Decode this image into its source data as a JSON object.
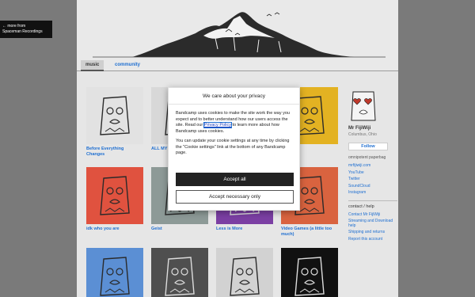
{
  "more_from": {
    "arrow": "←",
    "line1": "more from",
    "line2": "Spaceman Recordings"
  },
  "nav": {
    "music": "music",
    "community": "community"
  },
  "albums": [
    {
      "title": "Before Everything Changes",
      "color": "#e2e2e2"
    },
    {
      "title": "ALL MY",
      "color": "#d8d8d8"
    },
    {
      "title": "",
      "color": "#c9c9c9"
    },
    {
      "title": "D I",
      "color": "#e3b222"
    },
    {
      "title": "idk who you are",
      "color": "#e0523f"
    },
    {
      "title": "Geist",
      "color": "#8d9a97"
    },
    {
      "title": "Less is More",
      "color": "#7b3fa3"
    },
    {
      "title": "Video Games (a little too much)",
      "color": "#d9633f"
    },
    {
      "title": "",
      "color": "#5b8fd4"
    },
    {
      "title": "",
      "color": "#4f4f4f"
    },
    {
      "title": "",
      "color": "#d2d2d2"
    },
    {
      "title": "",
      "color": "#111111"
    }
  ],
  "sidebar": {
    "name": "Mr FijiWiji",
    "location": "Columbus, Ohio",
    "follow": "Follow",
    "description": "omnipotent paperbag",
    "links": [
      "mrfijiwiji.com",
      "YouTube",
      "Twitter",
      "SoundCloud",
      "Instagram"
    ],
    "contact_heading": "contact / help",
    "contact_links": [
      "Contact Mr FijiWiji",
      "Streaming and Download help",
      "Shipping and returns",
      "Report this account"
    ]
  },
  "cookie": {
    "title": "We care about your privacy",
    "para1_before": "Bandcamp uses cookies to make the site work the way you expect and to better understand how our users access the site. Read our ",
    "privacy_link": "Privacy Policy",
    "para1_after": " to learn more about how Bandcamp uses cookies.",
    "para2": "You can update your cookie settings at any time by clicking the \"Cookie settings\" link at the bottom of any Bandcamp page.",
    "accept_all": "Accept all",
    "accept_necessary": "Accept necessary only"
  }
}
